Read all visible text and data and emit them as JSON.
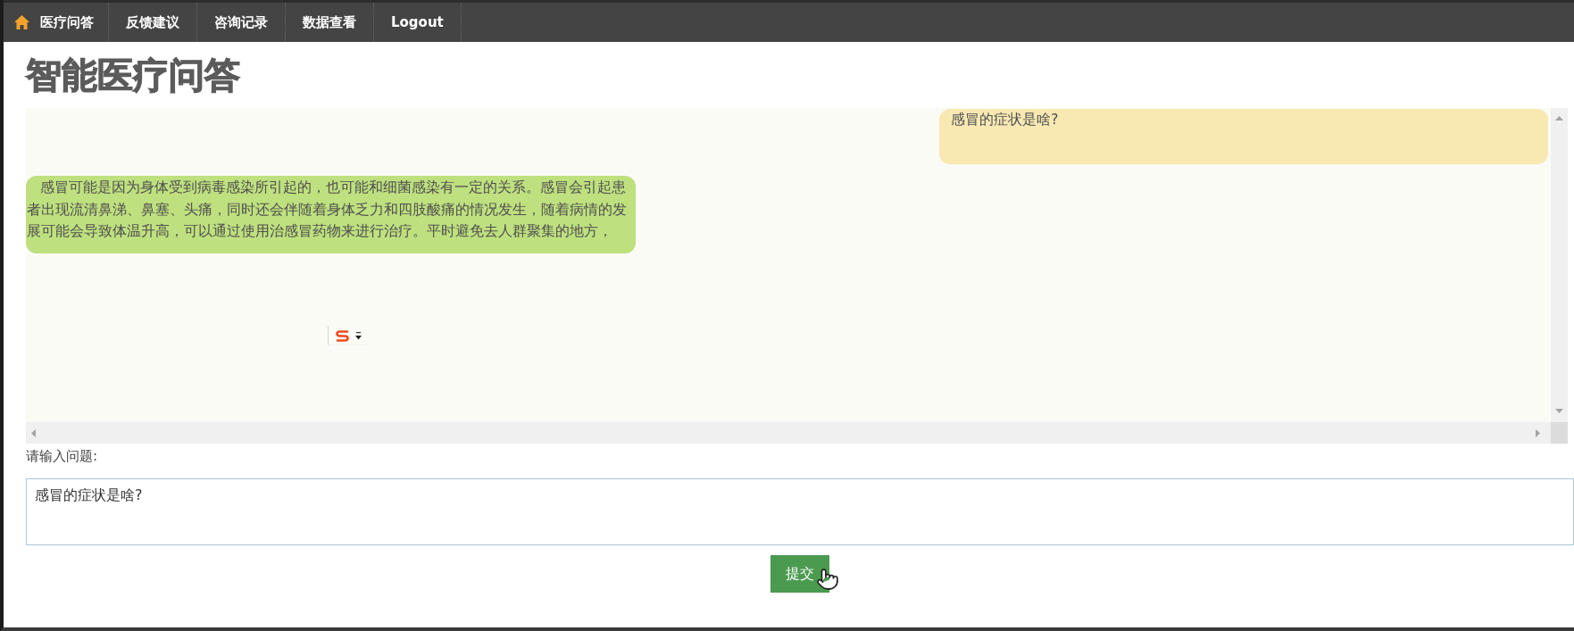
{
  "nav": {
    "items": [
      {
        "label": "医疗问答",
        "kind": "home"
      },
      {
        "label": "反馈建议",
        "kind": "link"
      },
      {
        "label": "咨询记录",
        "kind": "link"
      },
      {
        "label": "数据查看",
        "kind": "link"
      },
      {
        "label": "Logout",
        "kind": "link"
      }
    ]
  },
  "title": "智能医疗问答",
  "chat": {
    "messages": [
      {
        "kind": "question",
        "text": "感冒的症状是啥?"
      },
      {
        "kind": "answer",
        "text": "感冒可能是因为身体受到病毒感染所引起的，也可能和细菌感染有一定的关系。感冒会引起患者出现流清鼻涕、鼻塞、头痛，同时还会伴随着身体乏力和四肢酸痛的情况发生，随着病情的发展可能会导致体温升高，可以通过使用治感冒药物来进行治疗。平时避免去人群聚集的地方，"
      }
    ]
  },
  "question": {
    "label": "请输入问题:",
    "value": "感冒的症状是啥?"
  },
  "submit_button": {
    "label": "提交"
  }
}
